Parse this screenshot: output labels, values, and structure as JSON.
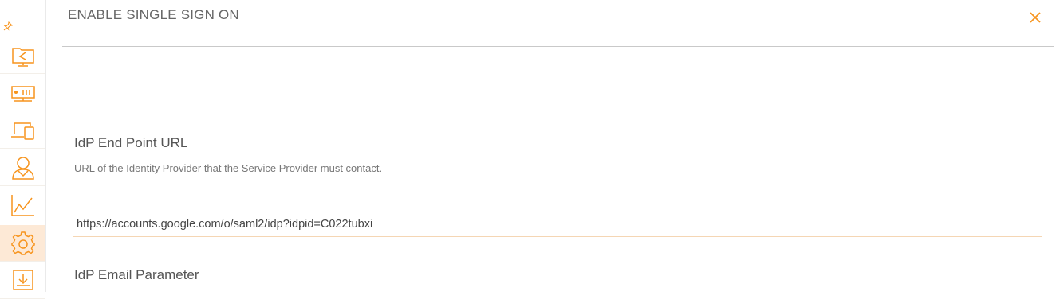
{
  "colors": {
    "accent": "#f7941d",
    "active_bg": "#fde9d6"
  },
  "sidebar": {
    "items": [
      {
        "icon": "folder-share-icon"
      },
      {
        "icon": "server-icon"
      },
      {
        "icon": "devices-icon"
      },
      {
        "icon": "user-icon"
      },
      {
        "icon": "chart-line-icon"
      },
      {
        "icon": "settings-gear-icon",
        "active": true
      },
      {
        "icon": "download-icon"
      }
    ]
  },
  "dialog": {
    "title": "ENABLE SINGLE SIGN ON",
    "idp_endpoint": {
      "label": "IdP End Point URL",
      "help": "URL of the Identity Provider that the Service Provider must contact.",
      "value": "https://accounts.google.com/o/saml2/idp?idpid=C022tubxi"
    },
    "idp_email": {
      "label": "IdP Email Parameter"
    }
  }
}
